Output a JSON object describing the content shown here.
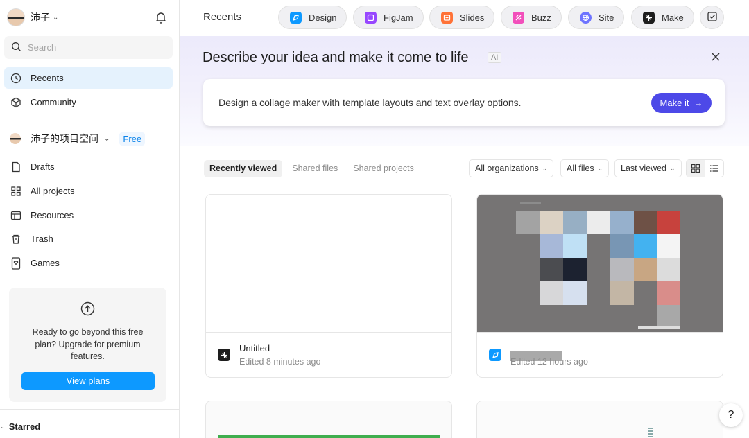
{
  "user": {
    "name": "沛子"
  },
  "search": {
    "placeholder": "Search"
  },
  "nav": {
    "recents": "Recents",
    "community": "Community"
  },
  "workspace": {
    "name": "沛子的项目空间",
    "plan_badge": "Free",
    "items": [
      "Drafts",
      "All projects",
      "Resources",
      "Trash",
      "Games"
    ]
  },
  "upgrade": {
    "text": "Ready to go beyond this free plan? Upgrade for premium features.",
    "button": "View plans"
  },
  "starred": "Starred",
  "topbar": {
    "title": "Recents",
    "pills": [
      "Design",
      "FigJam",
      "Slides",
      "Buzz",
      "Site",
      "Make"
    ]
  },
  "hero": {
    "title": "Describe your idea and make it come to life",
    "badge": "AI",
    "prompt": "Design a collage maker with template layouts and text overlay options.",
    "button": "Make it"
  },
  "tabs": [
    "Recently viewed",
    "Shared files",
    "Shared projects"
  ],
  "filters": [
    "All organizations",
    "All files",
    "Last viewed"
  ],
  "files": [
    {
      "name": "Untitled",
      "meta": "Edited 8 minutes ago"
    },
    {
      "name": "",
      "meta": "Edited 12 hours ago"
    }
  ],
  "help": "?",
  "colors": {
    "accent": "#0d99ff",
    "make_button": "#4d49e8",
    "active_nav": "#e5f2fd",
    "design_icon": "#0d99ff",
    "figjam_icon": "#9747ff",
    "slides_icon": "#ff7237",
    "buzz_icon": "#f24fbb",
    "site_icon": "#6e74ff",
    "make_icon": "#1e1e1e"
  }
}
